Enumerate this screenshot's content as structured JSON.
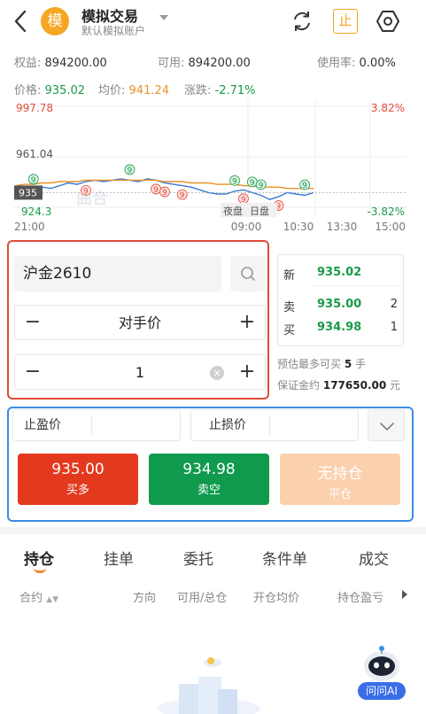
{
  "header": {
    "avatar_text": "模",
    "title": "模拟交易",
    "subtitle": "默认模拟账户",
    "stop_label": "止"
  },
  "account": {
    "equity_label": "权益:",
    "equity_value": "894200.00",
    "available_label": "可用:",
    "available_value": "894200.00",
    "usage_label": "使用率:",
    "usage_value": "0.00%"
  },
  "price_info": {
    "price_label": "价格:",
    "price_value": "935.02",
    "avg_label": "均价:",
    "avg_value": "941.24",
    "change_label": "涨跌:",
    "change_value": "-2.71%",
    "colors": {
      "green": "#1a9a4a",
      "orange": "#e8922a",
      "red": "#e24b3b"
    }
  },
  "chart_data": {
    "type": "line",
    "y_ticks": [
      "997.78",
      "961.04",
      "924.3"
    ],
    "right_ticks": [
      "3.82%",
      "-3.82%"
    ],
    "x_ticks": [
      "21:00",
      "09:00",
      "10:30",
      "13:30",
      "15:00"
    ],
    "current_price_tag": "935",
    "session_labels": [
      "夜盘",
      "日盘"
    ],
    "watermark": "曲合",
    "ylim": [
      924.3,
      997.78
    ],
    "series": [
      {
        "values": [
          933,
          934,
          937,
          939,
          938,
          940,
          942,
          941,
          943,
          944,
          943,
          944,
          945,
          944,
          943,
          945,
          944,
          942,
          941,
          940,
          939,
          937,
          935,
          934,
          934,
          936,
          937,
          935,
          933,
          930,
          932,
          935,
          934,
          933,
          935
        ]
      },
      {
        "values": [
          940,
          941,
          941,
          942,
          942,
          943,
          943,
          943,
          944,
          944,
          944,
          944,
          944,
          944,
          944,
          944,
          944,
          943,
          943,
          943,
          942,
          942,
          942,
          941,
          941,
          941,
          940,
          940,
          939,
          939,
          939,
          938,
          938,
          938,
          938
        ]
      }
    ],
    "markers": [
      {
        "label": "9",
        "color": "green",
        "i": 2,
        "up": true
      },
      {
        "label": "9",
        "color": "red",
        "i": 8,
        "up": false
      },
      {
        "label": "9",
        "color": "green",
        "i": 13,
        "up": true
      },
      {
        "label": "9",
        "color": "red",
        "i": 16,
        "up": false
      },
      {
        "label": "9",
        "color": "red",
        "i": 17,
        "up": false
      },
      {
        "label": "9",
        "color": "red",
        "i": 19,
        "up": false
      },
      {
        "label": "9",
        "color": "green",
        "i": 25,
        "up": true
      },
      {
        "label": "9",
        "color": "red",
        "i": 26,
        "up": false
      },
      {
        "label": "9",
        "color": "green",
        "i": 27,
        "up": true
      },
      {
        "label": "9",
        "color": "green",
        "i": 28,
        "up": true
      },
      {
        "label": "9",
        "color": "red",
        "i": 30,
        "up": false
      },
      {
        "label": "9",
        "color": "green",
        "i": 33,
        "up": true
      }
    ]
  },
  "order": {
    "symbol": "沪金2610",
    "price_type": "对手价",
    "quantity": "1",
    "minus": "−",
    "plus": "+"
  },
  "quote": {
    "last_label": "新",
    "last_value": "935.02",
    "ask_label": "卖",
    "ask_value": "935.00",
    "ask_vol": "2",
    "bid_label": "买",
    "bid_value": "934.98",
    "bid_vol": "1"
  },
  "estimate": {
    "max_label": "预估最多可买",
    "max_value": "5",
    "max_unit": "手",
    "margin_label": "保证金约",
    "margin_value": "177650.00",
    "margin_unit": "元"
  },
  "stops": {
    "take_profit_label": "止盈价",
    "stop_loss_label": "止损价"
  },
  "actions": {
    "buy_price": "935.00",
    "buy_label": "买多",
    "sell_price": "934.98",
    "sell_label": "卖空",
    "close_price": "无持仓",
    "close_label": "平仓",
    "colors": {
      "buy": "#e3391f",
      "sell": "#0f9a4d",
      "close": "#fbd0ad"
    }
  },
  "tabs": [
    "持仓",
    "挂单",
    "委托",
    "条件单",
    "成交"
  ],
  "columns": [
    "合约",
    "方向",
    "可用/总仓",
    "开仓均价",
    "持仓盈亏"
  ],
  "ai_label": "问问AI"
}
